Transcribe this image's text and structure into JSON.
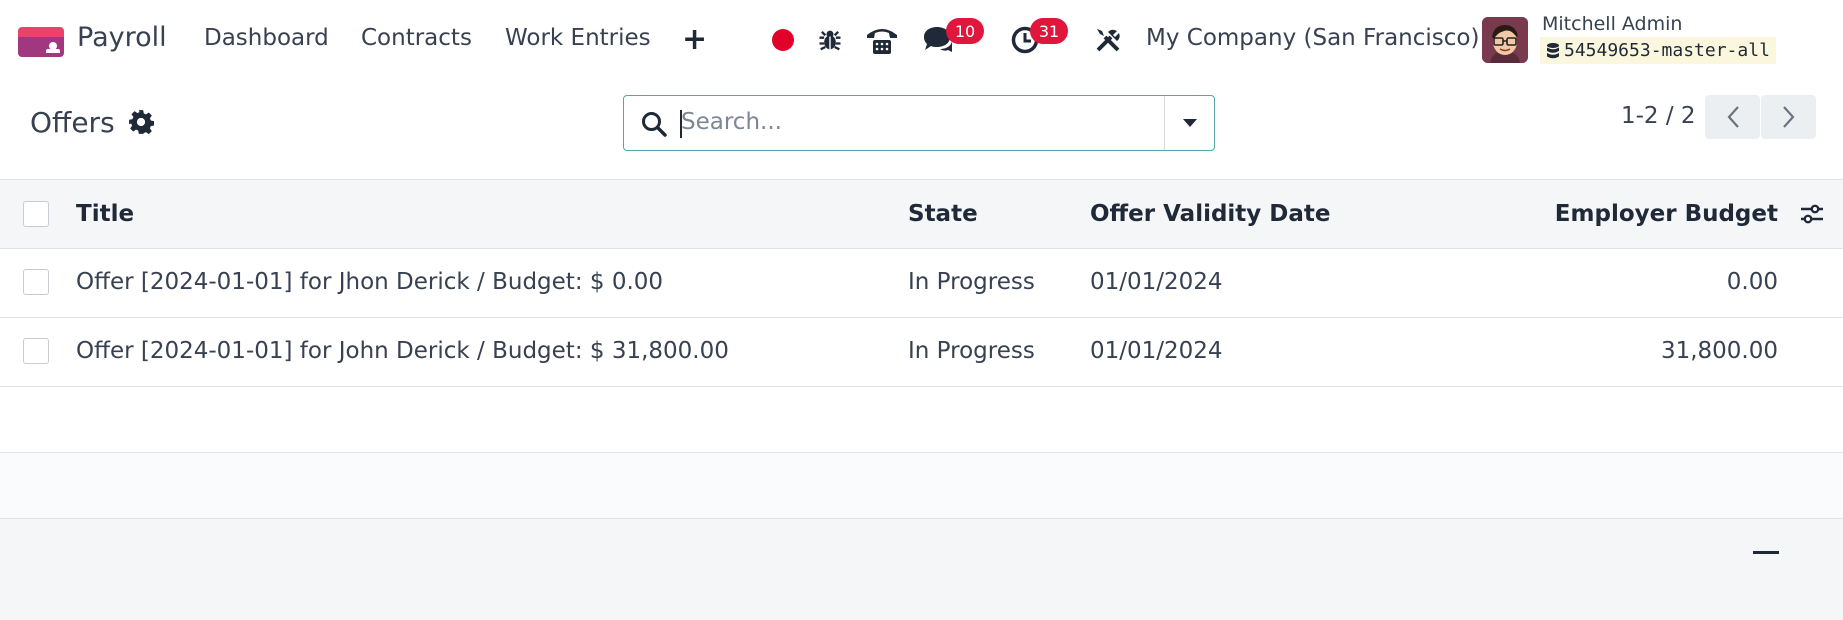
{
  "navbar": {
    "app_name": "Payroll",
    "menu": [
      "Dashboard",
      "Contracts",
      "Work Entries"
    ],
    "plus_label": "+",
    "messages_count": "10",
    "activities_count": "31",
    "company": "My Company (San Francisco)",
    "user_name": "Mitchell Admin",
    "database": "54549653-master-all",
    "colors": {
      "brand_top": "#e8436a",
      "brand_bottom": "#a1387f",
      "badge": "#e0163c",
      "recording": "#e0002a"
    },
    "icons": [
      "payroll-app-icon",
      "recording-icon",
      "bug-icon",
      "phone-icon",
      "chat-icon",
      "clock-icon",
      "tools-icon",
      "database-icon"
    ]
  },
  "control_panel": {
    "title": "Offers",
    "search_placeholder": "Search...",
    "pager": "1-2 / 2",
    "accent_color": "#52a6ac"
  },
  "table": {
    "columns": [
      "Title",
      "State",
      "Offer Validity Date",
      "Employer Budget"
    ],
    "rows": [
      {
        "title": "Offer [2024-01-01] for Jhon Derick / Budget: $ 0.00",
        "state": "In Progress",
        "date": "01/01/2024",
        "budget": "0.00"
      },
      {
        "title": "Offer [2024-01-01] for John Derick / Budget: $ 31,800.00",
        "state": "In Progress",
        "date": "01/01/2024",
        "budget": "31,800.00"
      }
    ]
  }
}
